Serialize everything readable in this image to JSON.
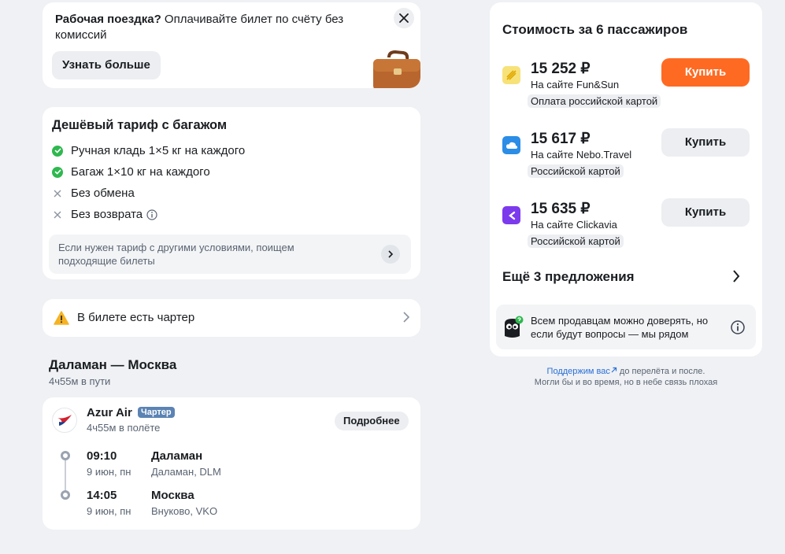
{
  "promo": {
    "title": "Рабочая поездка?",
    "text": " Оплачивайте билет по счёту без комиссий",
    "button": "Узнать больше"
  },
  "tariff": {
    "title": "Дешёвый тариф с багажом",
    "features": [
      {
        "label": "Ручная кладь 1×5 кг на каждого",
        "icon": "check-icon"
      },
      {
        "label": "Багаж 1×10 кг на каждого",
        "icon": "check-icon"
      },
      {
        "label": "Без обмена",
        "icon": "cross-icon"
      },
      {
        "label": "Без возврата",
        "icon": "cross-icon"
      }
    ],
    "hint": "Если нужен тариф с другими условиями, поищем подходящие билеты"
  },
  "charter": {
    "label": "В билете есть чартер"
  },
  "route": {
    "title": "Даламан — Москва",
    "duration": "4ч55м в пути"
  },
  "flight": {
    "airline": "Azur Air",
    "badge": "Чартер",
    "duration": "4ч55м в полёте",
    "more_button": "Подробнее",
    "departure": {
      "time": "09:10",
      "date": "9 июн, пн",
      "city": "Даламан",
      "airport": "Даламан, DLM"
    },
    "arrival": {
      "time": "14:05",
      "date": "9 июн, пн",
      "city": "Москва",
      "airport": "Внуково, VKO"
    }
  },
  "offers": {
    "title": "Стоимость за 6 пассажиров",
    "items": [
      {
        "price": "15 252 ₽",
        "site": "На сайте Fun&Sun",
        "payment": "Оплата российской картой",
        "button": "Купить",
        "logo_color": "#f7e27a"
      },
      {
        "price": "15 617 ₽",
        "site": "На сайте Nebo.Travel",
        "payment": "Российской картой",
        "button": "Купить",
        "logo_color": "#2b8de6"
      },
      {
        "price": "15 635 ₽",
        "site": "На сайте Clickavia",
        "payment": "Российской картой",
        "button": "Купить",
        "logo_color": "#7c3aed"
      }
    ],
    "more": "Ещё 3 предложения",
    "trust": "Всем продавцам можно доверять, но если будут вопросы — мы рядом",
    "accent": "#ff6a22"
  },
  "support": {
    "link": "Поддержим вас",
    "line1": " до перелёта и после.",
    "line2": "Могли бы и во время, но в небе связь плохая"
  }
}
